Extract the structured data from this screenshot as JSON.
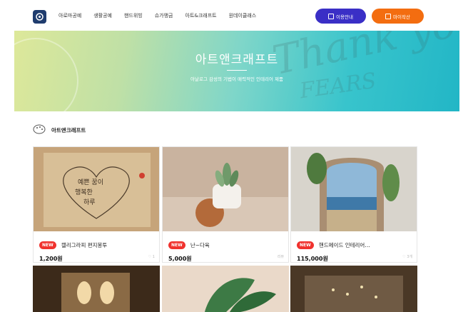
{
  "header": {
    "nav": [
      "아로마공예",
      "생활공예",
      "핸드위빙",
      "슈가앵금",
      "아트&크래프트",
      "원데이클래스"
    ],
    "guide_button": "이용안내",
    "mypage_button": "마이작산"
  },
  "banner": {
    "title": "아트앤크래프트",
    "subtitle": "아날로그 감성의 기법이 매력적인 인테리어 제품",
    "deco_text_1": "Thank you",
    "deco_text_2": "FEARS"
  },
  "section": {
    "title": "아트앤크래프트"
  },
  "products": [
    {
      "badge": "NEW",
      "name": "캘리그라피 편지봉투",
      "price": "1,200원",
      "meta": "♡  1"
    },
    {
      "badge": "NEW",
      "name": "난~다육",
      "price": "5,000원",
      "meta": "리뷰"
    },
    {
      "badge": "NEW",
      "name": "핸드메이드 인테리어…",
      "price": "115,000원",
      "meta": "♡ 3개"
    }
  ],
  "colors": {
    "guide_button": "#3a2fc6",
    "mypage_button": "#f36d10",
    "badge": "#f0322e"
  }
}
